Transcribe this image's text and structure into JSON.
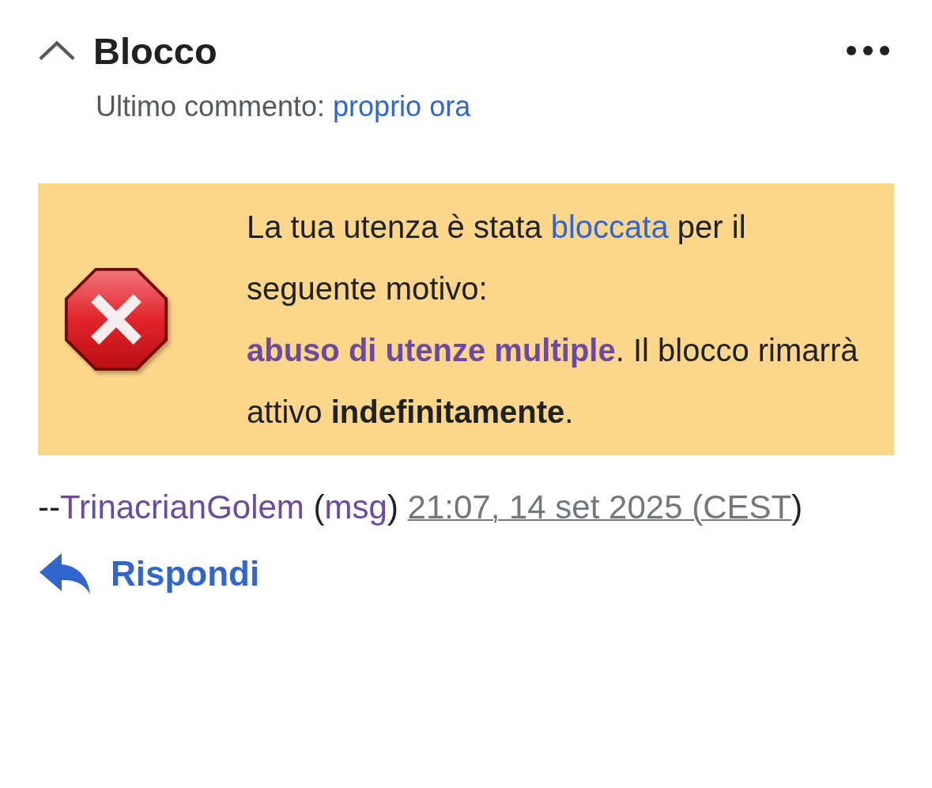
{
  "section": {
    "title": "Blocco",
    "expanded": true
  },
  "last_comment": {
    "label": "Ultimo commento: ",
    "link": "proprio ora"
  },
  "notice": {
    "segments": [
      {
        "kind": "text",
        "text": "La tua utenza è stata "
      },
      {
        "kind": "link",
        "text": "bloccata",
        "visited": false,
        "bold": false
      },
      {
        "kind": "text",
        "text": " per il seguente motivo: "
      },
      {
        "kind": "link",
        "text": "abuso di utenze multiple",
        "visited": true,
        "bold": true
      },
      {
        "kind": "text",
        "text": ". Il blocco rimarrà attivo **indefinitamente**."
      }
    ]
  },
  "signature": {
    "segments": [
      {
        "kind": "text",
        "text": "--"
      },
      {
        "kind": "link",
        "text": "TrinacrianGolem",
        "visited": true
      },
      {
        "kind": "text",
        "text": " ("
      },
      {
        "kind": "link",
        "text": "msg",
        "visited": true
      },
      {
        "kind": "text",
        "text": ") "
      },
      {
        "kind": "timestamp",
        "text": "21:07, 14 set 2025 (CEST"
      },
      {
        "kind": "text",
        "text": ")"
      }
    ]
  },
  "reply_button": {
    "label": "Rispondi"
  }
}
